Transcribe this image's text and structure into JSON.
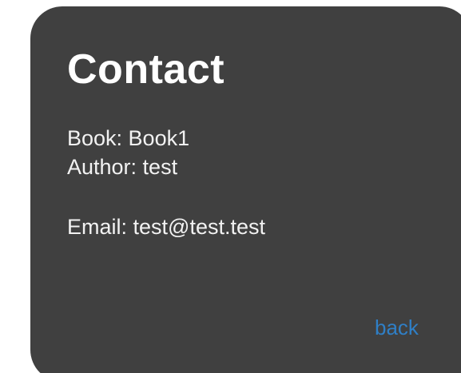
{
  "card": {
    "title": "Contact",
    "book_line": "Book: Book1",
    "author_line": "Author: test",
    "email_line": "Email: test@test.test",
    "back_label": "back"
  },
  "colors": {
    "card_background": "#404040",
    "text": "#ffffff",
    "link": "#2f7fc6"
  }
}
